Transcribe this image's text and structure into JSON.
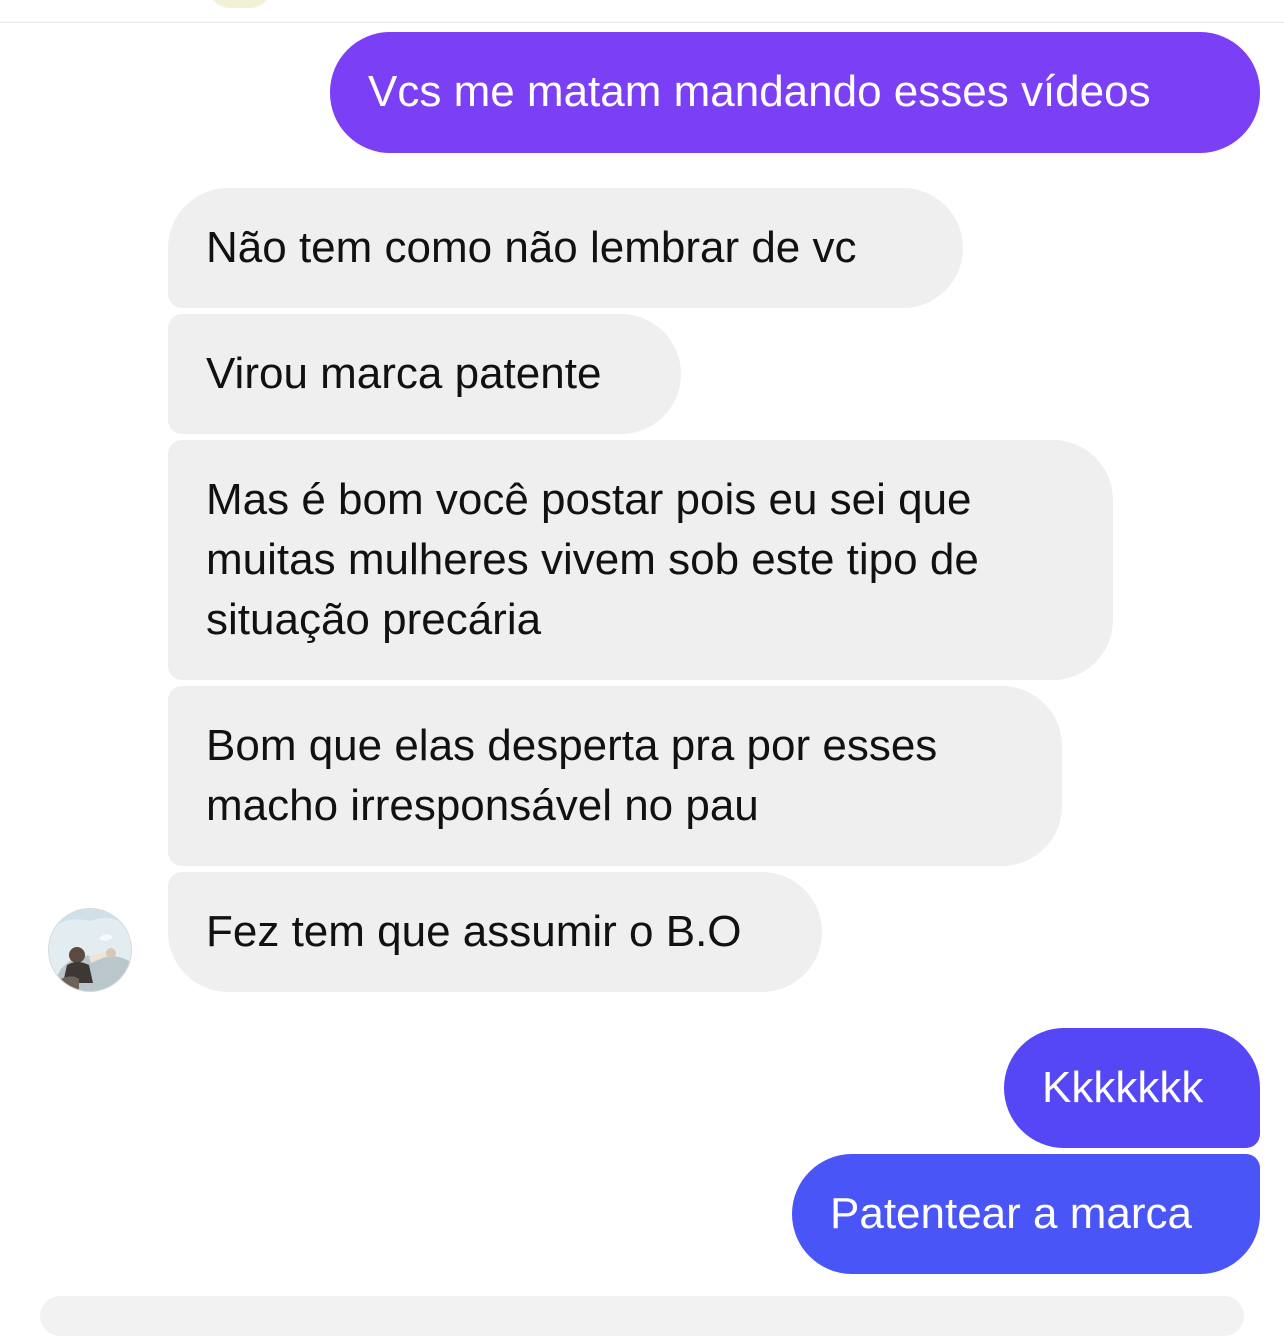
{
  "conversation": {
    "messages": [
      {
        "direction": "outgoing",
        "text": "Vcs me matam mandando esses vídeos",
        "color": "#7b3ff5"
      },
      {
        "direction": "incoming",
        "text": "Não tem como não lembrar de vc"
      },
      {
        "direction": "incoming",
        "text": "Virou marca patente"
      },
      {
        "direction": "incoming",
        "text": "Mas é bom você postar pois eu sei que muitas mulheres vivem sob este tipo de situação precária"
      },
      {
        "direction": "incoming",
        "text": "Bom que elas desperta pra por esses macho irresponsável no pau"
      },
      {
        "direction": "incoming",
        "text": "Fez tem que assumir o B.O"
      },
      {
        "direction": "outgoing",
        "text": "Kkkkkkk",
        "color": "#5547f5"
      },
      {
        "direction": "outgoing",
        "text": "Patentear a marca",
        "color": "#4a55f7"
      }
    ],
    "incoming_bubble_color": "#efefef",
    "sender_avatar_icon": "user-avatar-photo"
  }
}
